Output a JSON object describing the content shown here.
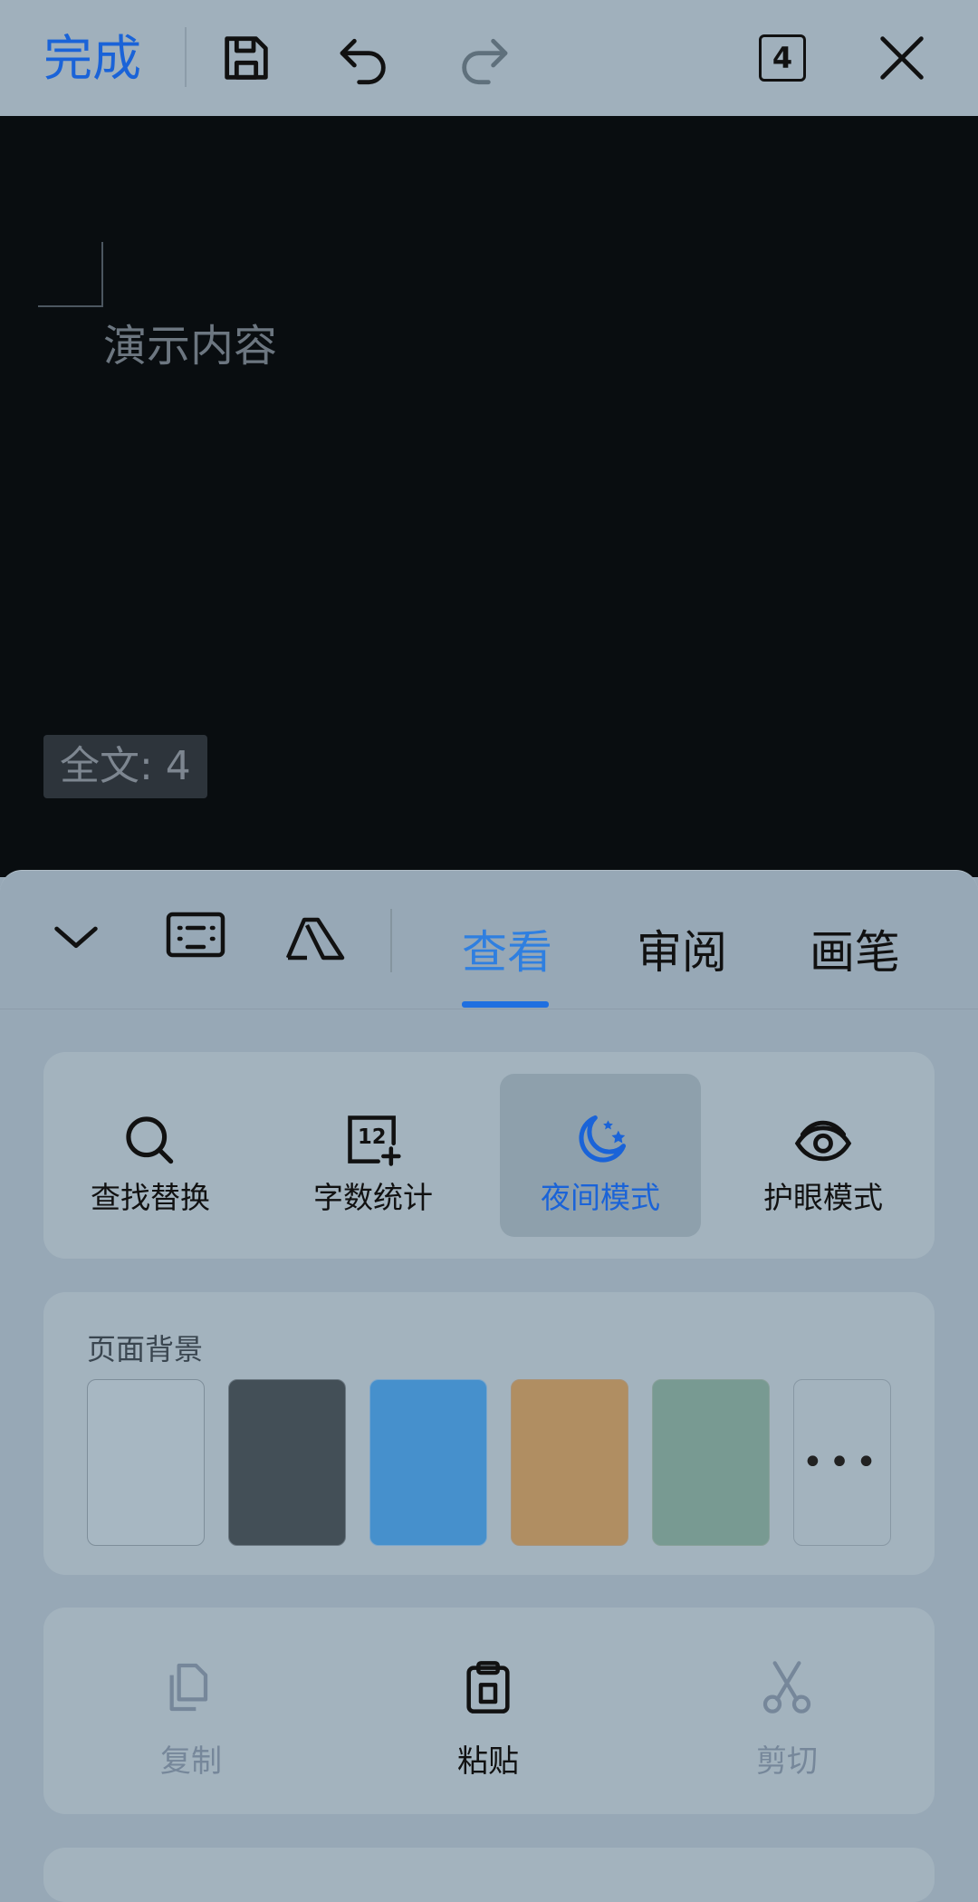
{
  "topbar": {
    "done_label": "完成",
    "page_count": "4",
    "icons": [
      "save-icon",
      "undo-icon",
      "redo-icon",
      "page-count-icon",
      "close-icon"
    ]
  },
  "document": {
    "text": "演示内容",
    "word_count": "全文: 4"
  },
  "sheet": {
    "icons": [
      "chevron-down-icon",
      "keyboard-icon",
      "format-icon"
    ],
    "tabs": [
      {
        "label": "查看",
        "active": true
      },
      {
        "label": "审阅",
        "active": false
      },
      {
        "label": "画笔",
        "active": false
      }
    ],
    "view_tools": [
      {
        "label": "查找替换",
        "icon": "search-icon",
        "active": false
      },
      {
        "label": "字数统计",
        "icon": "word-count-icon",
        "active": false
      },
      {
        "label": "夜间模式",
        "icon": "night-mode-icon",
        "active": true
      },
      {
        "label": "护眼模式",
        "icon": "eye-icon",
        "active": false
      }
    ],
    "page_background": {
      "title": "页面背景",
      "swatches": [
        "#a7b7c2",
        "#434f57",
        "#4690cc",
        "#b08e62",
        "#789a92"
      ],
      "more_label": "•••"
    },
    "clipboard": [
      {
        "label": "复制",
        "icon": "copy-icon",
        "enabled": false
      },
      {
        "label": "粘贴",
        "icon": "paste-icon",
        "enabled": true
      },
      {
        "label": "剪切",
        "icon": "scissors-icon",
        "enabled": false
      }
    ]
  },
  "colors": {
    "accent": "#1a63d8",
    "active_tab": "#2f7fe0",
    "document_bg": "#090d10"
  }
}
